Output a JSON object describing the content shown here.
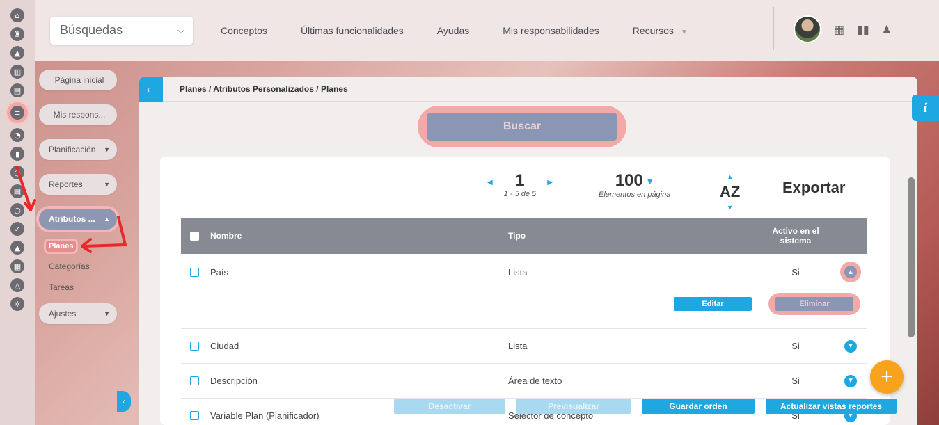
{
  "topbar": {
    "search_label": "Búsquedas",
    "nav": [
      "Conceptos",
      "Últimas funcionalidades",
      "Ayudas",
      "Mis responsabilidades",
      "Recursos"
    ]
  },
  "submenu": {
    "pagina_inicial": "Página inicial",
    "mis_respons": "Mis respons...",
    "planificacion": "Planificación",
    "reportes": "Reportes",
    "atributos": "Atributos ...",
    "planes": "Planes",
    "categorias": "Categorías",
    "tareas": "Tareas",
    "ajustes": "Ajustes"
  },
  "breadcrumb": "Planes / Atributos Personalizados / Planes",
  "buscar": "Buscar",
  "pager": {
    "page": "1",
    "range": "1 - 5 de 5",
    "per_page": "100",
    "per_page_label": "Elementos en página",
    "sort": "AZ",
    "export": "Exportar"
  },
  "table": {
    "headers": {
      "name": "Nombre",
      "type": "Tipo",
      "active": "Activo en el sistema"
    },
    "rows": [
      {
        "name": "País",
        "type": "Lista",
        "active": "Si"
      },
      {
        "name": "Ciudad",
        "type": "Lista",
        "active": "Si"
      },
      {
        "name": "Descripción",
        "type": "Área de texto",
        "active": "Si"
      },
      {
        "name": "Variable Plan (Planificador)",
        "type": "Selector de concepto",
        "active": "Si"
      }
    ],
    "edit": "Editar",
    "delete": "Eliminar"
  },
  "bottom": {
    "deactivate": "Desactivar",
    "preview": "Previsualizar",
    "save_order": "Guardar orden",
    "update_reports": "Actualizar vistas reportes"
  },
  "info": "i",
  "colors": {
    "accent": "#1ea7e0",
    "highlight": "#f4a9a9",
    "fab": "#f9a21b"
  }
}
